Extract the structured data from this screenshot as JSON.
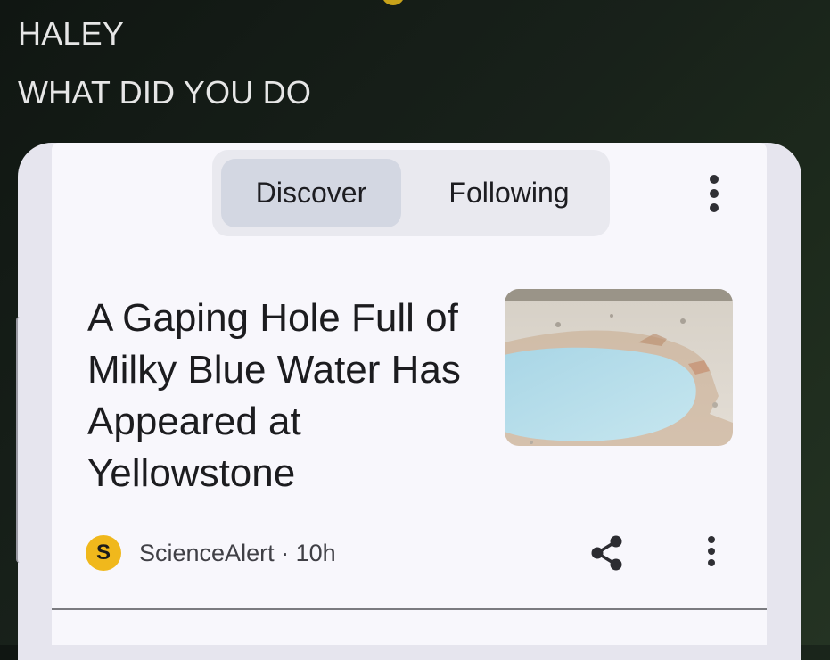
{
  "caption": {
    "line1": "HALEY",
    "line2": "WHAT DID YOU DO"
  },
  "feed_tabs": {
    "discover": "Discover",
    "following": "Following",
    "selected": "Discover"
  },
  "article": {
    "headline": "A Gaping Hole Full of Milky Blue Water Has Appeared at Yellowstone",
    "source_initial": "S",
    "source": "ScienceAlert",
    "separator": " · ",
    "age": "10h"
  },
  "colors": {
    "selected_tab": "#d3d7e2",
    "source_logo": "#f0b81c"
  },
  "icons": [
    "more-vert-icon",
    "share-icon"
  ]
}
